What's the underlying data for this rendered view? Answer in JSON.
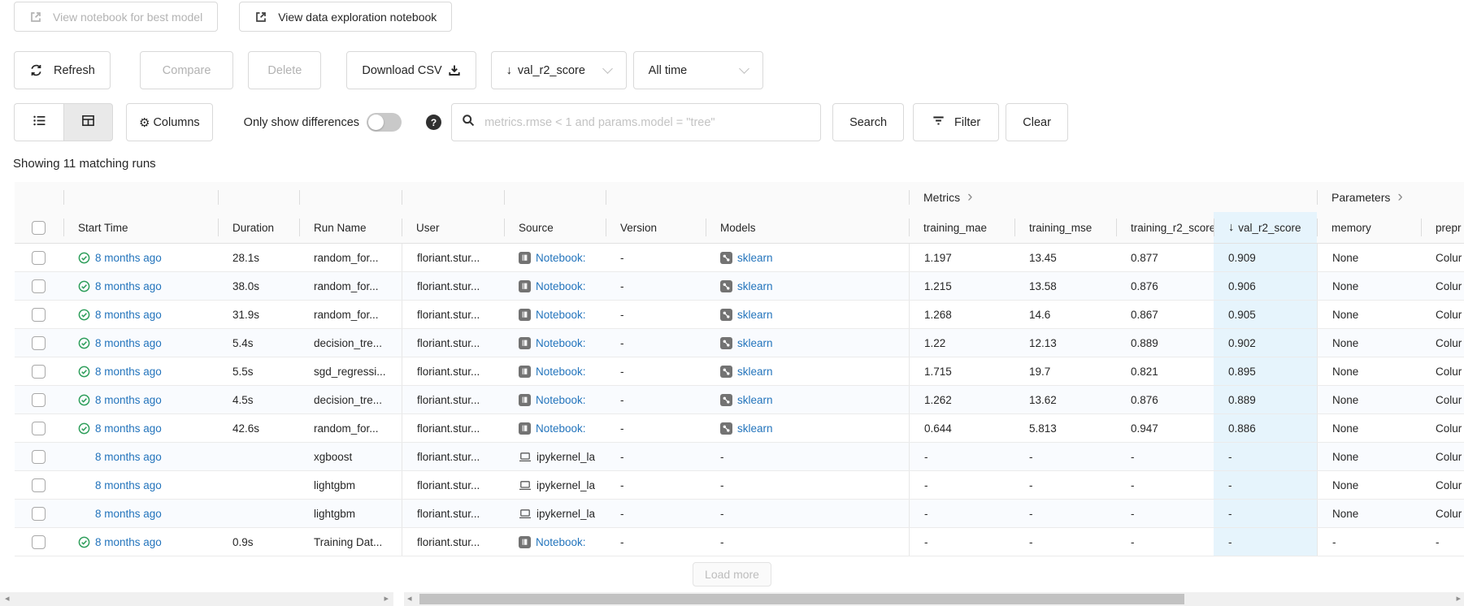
{
  "topbar": {
    "view_best_model_notebook": "View notebook for best model",
    "view_data_exploration_notebook": "View data exploration notebook"
  },
  "toolbar": {
    "refresh": "Refresh",
    "compare": "Compare",
    "delete": "Delete",
    "download_csv": "Download CSV",
    "sort_value": "val_r2_score",
    "time_range": "All time",
    "columns": "Columns",
    "only_show_differences": "Only show differences",
    "search_placeholder": "metrics.rmse < 1 and params.model = \"tree\"",
    "search": "Search",
    "filter": "Filter",
    "clear": "Clear"
  },
  "status_line": "Showing 11 matching runs",
  "table": {
    "groups": {
      "metrics": "Metrics",
      "parameters": "Parameters"
    },
    "columns": [
      "Start Time",
      "Duration",
      "Run Name",
      "User",
      "Source",
      "Version",
      "Models",
      "training_mae",
      "training_mse",
      "training_r2_score",
      "val_r2_score",
      "memory",
      "prepr"
    ],
    "sort": {
      "column": "val_r2_score",
      "direction": "descending"
    },
    "rows": [
      {
        "start_time": "8 months ago",
        "completed": true,
        "duration": "28.1s",
        "run_name": "random_for...",
        "user": "floriant.stur...",
        "source_type": "notebook",
        "source": "Notebook:",
        "version": "-",
        "model": "sklearn",
        "training_mae": "1.197",
        "training_mse": "13.45",
        "training_r2_score": "0.877",
        "val_r2_score": "0.909",
        "memory": "None",
        "preprocessor": "Colur"
      },
      {
        "start_time": "8 months ago",
        "completed": true,
        "duration": "38.0s",
        "run_name": "random_for...",
        "user": "floriant.stur...",
        "source_type": "notebook",
        "source": "Notebook:",
        "version": "-",
        "model": "sklearn",
        "training_mae": "1.215",
        "training_mse": "13.58",
        "training_r2_score": "0.876",
        "val_r2_score": "0.906",
        "memory": "None",
        "preprocessor": "Colur"
      },
      {
        "start_time": "8 months ago",
        "completed": true,
        "duration": "31.9s",
        "run_name": "random_for...",
        "user": "floriant.stur...",
        "source_type": "notebook",
        "source": "Notebook:",
        "version": "-",
        "model": "sklearn",
        "training_mae": "1.268",
        "training_mse": "14.6",
        "training_r2_score": "0.867",
        "val_r2_score": "0.905",
        "memory": "None",
        "preprocessor": "Colur"
      },
      {
        "start_time": "8 months ago",
        "completed": true,
        "duration": "5.4s",
        "run_name": "decision_tre...",
        "user": "floriant.stur...",
        "source_type": "notebook",
        "source": "Notebook:",
        "version": "-",
        "model": "sklearn",
        "training_mae": "1.22",
        "training_mse": "12.13",
        "training_r2_score": "0.889",
        "val_r2_score": "0.902",
        "memory": "None",
        "preprocessor": "Colur"
      },
      {
        "start_time": "8 months ago",
        "completed": true,
        "duration": "5.5s",
        "run_name": "sgd_regressi...",
        "user": "floriant.stur...",
        "source_type": "notebook",
        "source": "Notebook:",
        "version": "-",
        "model": "sklearn",
        "training_mae": "1.715",
        "training_mse": "19.7",
        "training_r2_score": "0.821",
        "val_r2_score": "0.895",
        "memory": "None",
        "preprocessor": "Colur"
      },
      {
        "start_time": "8 months ago",
        "completed": true,
        "duration": "4.5s",
        "run_name": "decision_tre...",
        "user": "floriant.stur...",
        "source_type": "notebook",
        "source": "Notebook:",
        "version": "-",
        "model": "sklearn",
        "training_mae": "1.262",
        "training_mse": "13.62",
        "training_r2_score": "0.876",
        "val_r2_score": "0.889",
        "memory": "None",
        "preprocessor": "Colur"
      },
      {
        "start_time": "8 months ago",
        "completed": true,
        "duration": "42.6s",
        "run_name": "random_for...",
        "user": "floriant.stur...",
        "source_type": "notebook",
        "source": "Notebook:",
        "version": "-",
        "model": "sklearn",
        "training_mae": "0.644",
        "training_mse": "5.813",
        "training_r2_score": "0.947",
        "val_r2_score": "0.886",
        "memory": "None",
        "preprocessor": "Colur"
      },
      {
        "start_time": "8 months ago",
        "completed": false,
        "duration": "",
        "run_name": "xgboost",
        "user": "floriant.stur...",
        "source_type": "kernel",
        "source": "ipykernel_la",
        "version": "-",
        "model": "-",
        "training_mae": "-",
        "training_mse": "-",
        "training_r2_score": "-",
        "val_r2_score": "-",
        "memory": "None",
        "preprocessor": "Colur"
      },
      {
        "start_time": "8 months ago",
        "completed": false,
        "duration": "",
        "run_name": "lightgbm",
        "user": "floriant.stur...",
        "source_type": "kernel",
        "source": "ipykernel_la",
        "version": "-",
        "model": "-",
        "training_mae": "-",
        "training_mse": "-",
        "training_r2_score": "-",
        "val_r2_score": "-",
        "memory": "None",
        "preprocessor": "Colur"
      },
      {
        "start_time": "8 months ago",
        "completed": false,
        "duration": "",
        "run_name": "lightgbm",
        "user": "floriant.stur...",
        "source_type": "kernel",
        "source": "ipykernel_la",
        "version": "-",
        "model": "-",
        "training_mae": "-",
        "training_mse": "-",
        "training_r2_score": "-",
        "val_r2_score": "-",
        "memory": "None",
        "preprocessor": "Colur"
      },
      {
        "start_time": "8 months ago",
        "completed": true,
        "duration": "0.9s",
        "run_name": "Training Dat...",
        "user": "floriant.stur...",
        "source_type": "notebook",
        "source": "Notebook:",
        "version": "-",
        "model": "-",
        "training_mae": "-",
        "training_mse": "-",
        "training_r2_score": "-",
        "val_r2_score": "-",
        "memory": "-",
        "preprocessor": "-"
      }
    ]
  },
  "load_more": "Load more",
  "colors": {
    "link_blue": "#2374bc",
    "success_green": "#2e9e5b",
    "sorted_column_highlight": "#e6f4fc"
  }
}
